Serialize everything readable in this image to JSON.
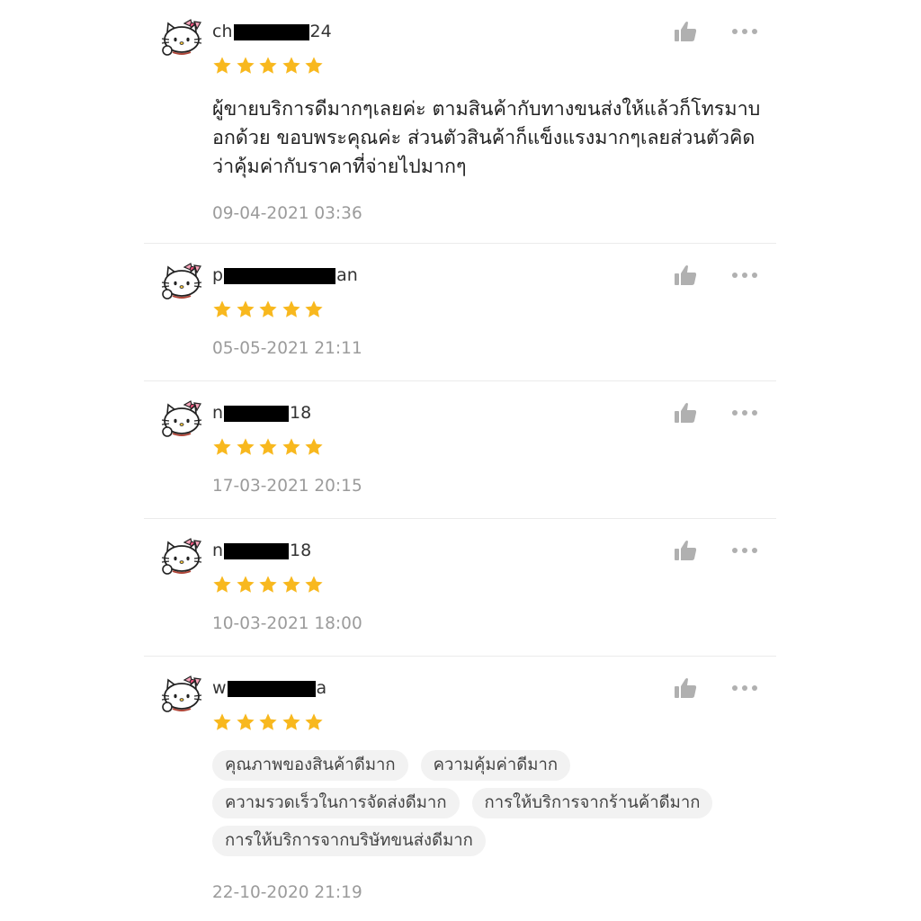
{
  "colors": {
    "star": "#f8b81e",
    "date": "#9b9b9b",
    "icon": "#b0b0b0",
    "divider": "#ebebeb",
    "tag_bg": "#f2f2f2"
  },
  "icons": {
    "avatar": "hello-kitty-avatar-icon",
    "like": "thumbs-up-icon",
    "more": "more-dots-icon",
    "star": "star-icon"
  },
  "reviews": [
    {
      "user_prefix": "ch",
      "user_suffix": "24",
      "rating": 5,
      "comment": "ผู้ขายบริการดีมากๆเลยค่ะ ตามสินค้ากับทางขนส่งให้แล้วก็โทรมาบอกด้วย ขอบพระคุณค่ะ ส่วนตัวสินค้าก็แข็งแรงมากๆเลยส่วนตัวคิดว่าคุ้มค่ากับราคาที่จ่ายไปมากๆ",
      "date": "09-04-2021 03:36"
    },
    {
      "user_prefix": "p",
      "user_suffix": "an",
      "rating": 5,
      "date": "05-05-2021 21:11"
    },
    {
      "user_prefix": "n",
      "user_suffix": "18",
      "rating": 5,
      "date": "17-03-2021 20:15"
    },
    {
      "user_prefix": "n",
      "user_suffix": "18",
      "rating": 5,
      "date": "10-03-2021 18:00"
    },
    {
      "user_prefix": "w",
      "user_suffix": "a",
      "rating": 5,
      "tags": [
        "คุณภาพของสินค้าดีมาก",
        "ความคุ้มค่าดีมาก",
        "ความรวดเร็วในการจัดส่งดีมาก",
        "การให้บริการจากร้านค้าดีมาก",
        "การให้บริการจากบริษัทขนส่งดีมาก"
      ],
      "date": "22-10-2020 21:19"
    }
  ]
}
